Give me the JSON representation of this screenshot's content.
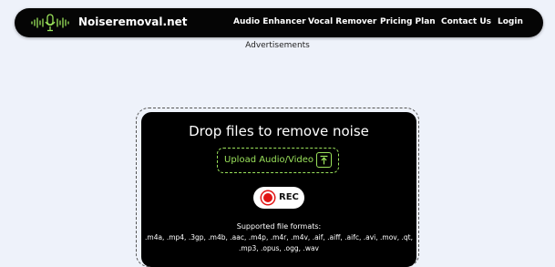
{
  "header": {
    "brand": "Noiseremoval.net",
    "nav": [
      {
        "label": "Audio Enhancer"
      },
      {
        "label": "Vocal Remover"
      },
      {
        "label": "Pricing Plan"
      },
      {
        "label": "Contact Us"
      },
      {
        "label": "Login"
      }
    ]
  },
  "ads_label": "Advertisements",
  "dropzone": {
    "title": "Drop files to remove noise",
    "upload_label": "Upload Audio/Video",
    "rec_label": "REC",
    "formats_title": "Supported file formats:",
    "formats_line1": ".m4a, .mp4, .3gp, .m4b, .aac, .m4p, .m4r, .m4v, .aif, .aiff, .aifc, .avi, .mov, .qt,",
    "formats_line2": ".mp3, .opus, .ogg, .wav"
  },
  "colors": {
    "accent_green": "#9be35b",
    "rec_red": "#e11414"
  },
  "icons": [
    "microphone-waveform-logo-icon",
    "upload-arrow-icon",
    "record-dot-icon"
  ]
}
